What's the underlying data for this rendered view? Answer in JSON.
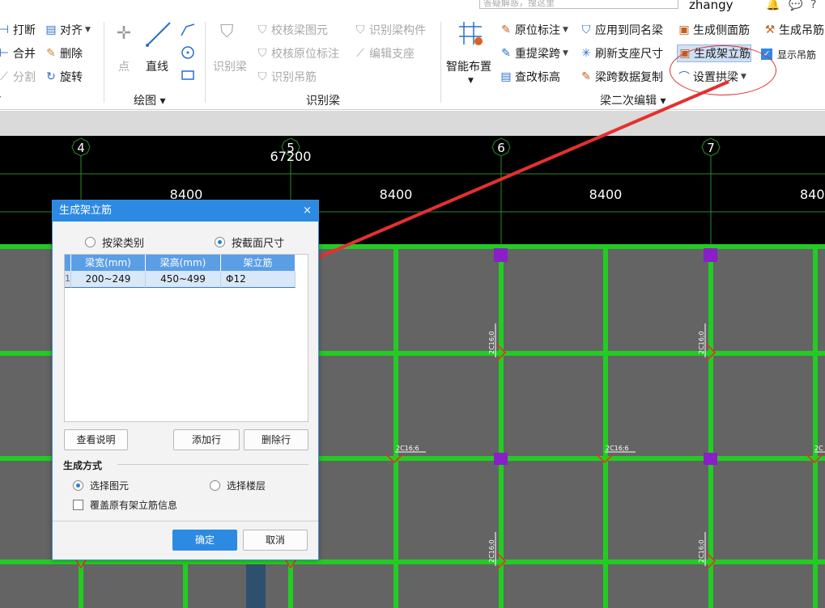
{
  "topbar": {
    "search_placeholder": "答疑解惑，搜这里",
    "username": "zhangy"
  },
  "ribbon": {
    "modify": {
      "items": [
        {
          "label": "打断",
          "icon": "break-icon"
        },
        {
          "label": "对齐",
          "icon": "align-icon"
        },
        {
          "label": "合并",
          "icon": "merge-icon"
        },
        {
          "label": "删除",
          "icon": "delete-icon"
        },
        {
          "label": "分割",
          "icon": "split-icon"
        },
        {
          "label": "旋转",
          "icon": "rotate-icon"
        }
      ]
    },
    "draw": {
      "point": "点",
      "line": "直线",
      "group_label": "绘图"
    },
    "identify": {
      "group_label": "识别梁",
      "identify_beam": "识别梁",
      "check_element": "校核梁图元",
      "check_annotation": "校核原位标注",
      "identify_hanger": "识别吊筋",
      "identify_member": "识别梁构件",
      "edit_support": "编辑支座"
    },
    "edit": {
      "group_label": "梁二次编辑",
      "smart_layout": "智能布置",
      "in_situ_mark": "原位标注",
      "re_extract_span": "重提梁跨",
      "check_elevation": "查改标高",
      "apply_same_name": "应用到同名梁",
      "refresh_support": "刷新支座尺寸",
      "copy_span_data": "梁跨数据复制",
      "gen_side_rebar": "生成侧面筋",
      "gen_erection_bar": "生成架立筋",
      "set_arch_beam": "设置拱梁",
      "gen_hanger": "生成吊筋",
      "show_hanger": "显示吊筋"
    }
  },
  "canvas": {
    "axes": [
      "4",
      "5",
      "6",
      "7"
    ],
    "total_dim": "67200",
    "span_dims": [
      "8400",
      "8400",
      "8400",
      "840"
    ],
    "rebar_labels": [
      "2C16;0",
      "2C16;6",
      "2C16;6",
      "2C16;0",
      "2C16;0",
      "2C16;0",
      "2C16;0",
      "2C"
    ]
  },
  "dialog": {
    "title": "生成架立筋",
    "close": "×",
    "radio_by_category": "按梁类别",
    "radio_by_section": "按截面尺寸",
    "table": {
      "headers": [
        "梁宽(mm)",
        "梁高(mm)",
        "架立筋"
      ],
      "rows": [
        {
          "index": "1",
          "width": "200~249",
          "height": "450~499",
          "bar": "Φ12"
        }
      ]
    },
    "btn_view_help": "查看说明",
    "btn_add_row": "添加行",
    "btn_delete_row": "删除行",
    "gen_mode_label": "生成方式",
    "radio_select_element": "选择图元",
    "radio_select_floor": "选择楼层",
    "checkbox_overwrite": "覆盖原有架立筋信息",
    "btn_ok": "确定",
    "btn_cancel": "取消"
  },
  "colors": {
    "beam": "#22cc22",
    "slab": "#646464",
    "column": "#8a1ec8",
    "dialog_header": "#2d8ae2",
    "annotation_arrow": "#e53030"
  }
}
